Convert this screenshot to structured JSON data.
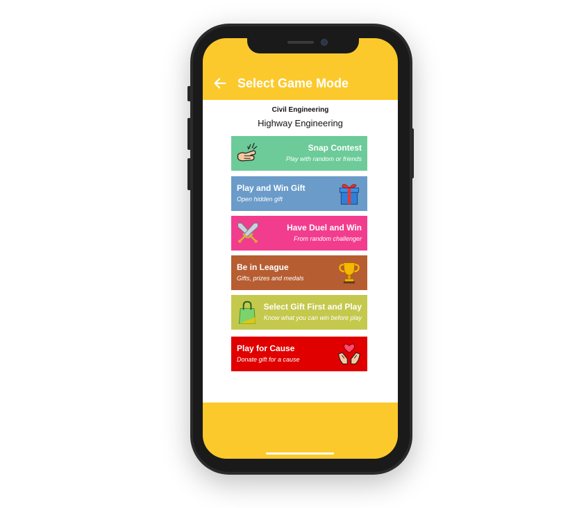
{
  "header": {
    "title": "Select Game Mode"
  },
  "quiz": {
    "subject": "Civil Engineering",
    "topic": "Highway Engineering"
  },
  "modes": [
    {
      "title": "Snap Contest",
      "subtitle": "Play with random or friends",
      "color": "#6ccb98",
      "icon": "snap-fingers-icon"
    },
    {
      "title": "Play and Win Gift",
      "subtitle": "Open hidden gift",
      "color": "#6a9bc9",
      "icon": "gift-box-icon"
    },
    {
      "title": "Have Duel and Win",
      "subtitle": "From random challenger",
      "color": "#f23d8e",
      "icon": "crossed-swords-icon"
    },
    {
      "title": "Be in League",
      "subtitle": "Gifts, prizes and medals",
      "color": "#b65d31",
      "icon": "trophy-icon"
    },
    {
      "title": "Select Gift First and Play",
      "subtitle": "Know what you can win before play",
      "color": "#c4c94d",
      "icon": "shopping-bag-icon"
    },
    {
      "title": "Play for Cause",
      "subtitle": "Donate gift for a cause",
      "color": "#e00000",
      "icon": "heart-hands-icon"
    }
  ],
  "colors": {
    "accent": "#fcc92c",
    "frame": "#2b2b2d"
  }
}
